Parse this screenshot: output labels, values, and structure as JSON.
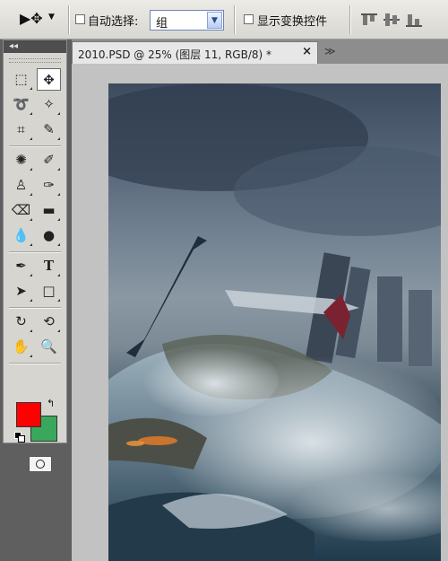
{
  "options_bar": {
    "tool_preset_icon": "move-tool-icon",
    "auto_select_label": "自动选择:",
    "auto_select_checked": false,
    "auto_select_mode": "组",
    "show_transform_label": "显示变换控件",
    "show_transform_checked": false,
    "align_icons": [
      "align-top-icon",
      "align-vertical-center-icon",
      "align-bottom-icon"
    ]
  },
  "toolbox": {
    "collapse_glyph": "◂◂",
    "tools": [
      {
        "name": "rectangular-marquee-tool",
        "glyph": "⬚"
      },
      {
        "name": "move-tool",
        "glyph": "✥",
        "active": true
      },
      {
        "name": "lasso-tool",
        "glyph": "➰"
      },
      {
        "name": "magic-wand-tool",
        "glyph": "✧"
      },
      {
        "name": "crop-tool",
        "glyph": "⌗"
      },
      {
        "name": "eyedropper-tool",
        "glyph": "✎"
      },
      {
        "name": "spot-healing-tool",
        "glyph": "✺"
      },
      {
        "name": "brush-tool",
        "glyph": "✐"
      },
      {
        "name": "clone-stamp-tool",
        "glyph": "♙"
      },
      {
        "name": "history-brush-tool",
        "glyph": "✑"
      },
      {
        "name": "eraser-tool",
        "glyph": "⌫"
      },
      {
        "name": "gradient-tool",
        "glyph": "▬"
      },
      {
        "name": "blur-tool",
        "glyph": "💧"
      },
      {
        "name": "dodge-tool",
        "glyph": "●"
      },
      {
        "name": "pen-tool",
        "glyph": "✒"
      },
      {
        "name": "type-tool",
        "glyph": "T"
      },
      {
        "name": "path-selection-tool",
        "glyph": "➤"
      },
      {
        "name": "rectangle-shape-tool",
        "glyph": "□"
      },
      {
        "name": "3d-rotate-tool",
        "glyph": "↻"
      },
      {
        "name": "3d-orbit-tool",
        "glyph": "⟲"
      },
      {
        "name": "hand-tool",
        "glyph": "✋"
      },
      {
        "name": "zoom-tool",
        "glyph": "🔍"
      }
    ],
    "foreground_color": "#ff0000",
    "background_color": "#3aa85c",
    "swap_glyph": "↰"
  },
  "document": {
    "tab_title": "2010.PSD @ 25% (图层 11, RGB/8) *",
    "close_glyph": "×",
    "more_glyph": "≫"
  },
  "colors": {
    "accent_select": "#6d86b6",
    "toolbox_bg": "#d6d5d0",
    "workspace_bg": "#c2c2c2"
  }
}
